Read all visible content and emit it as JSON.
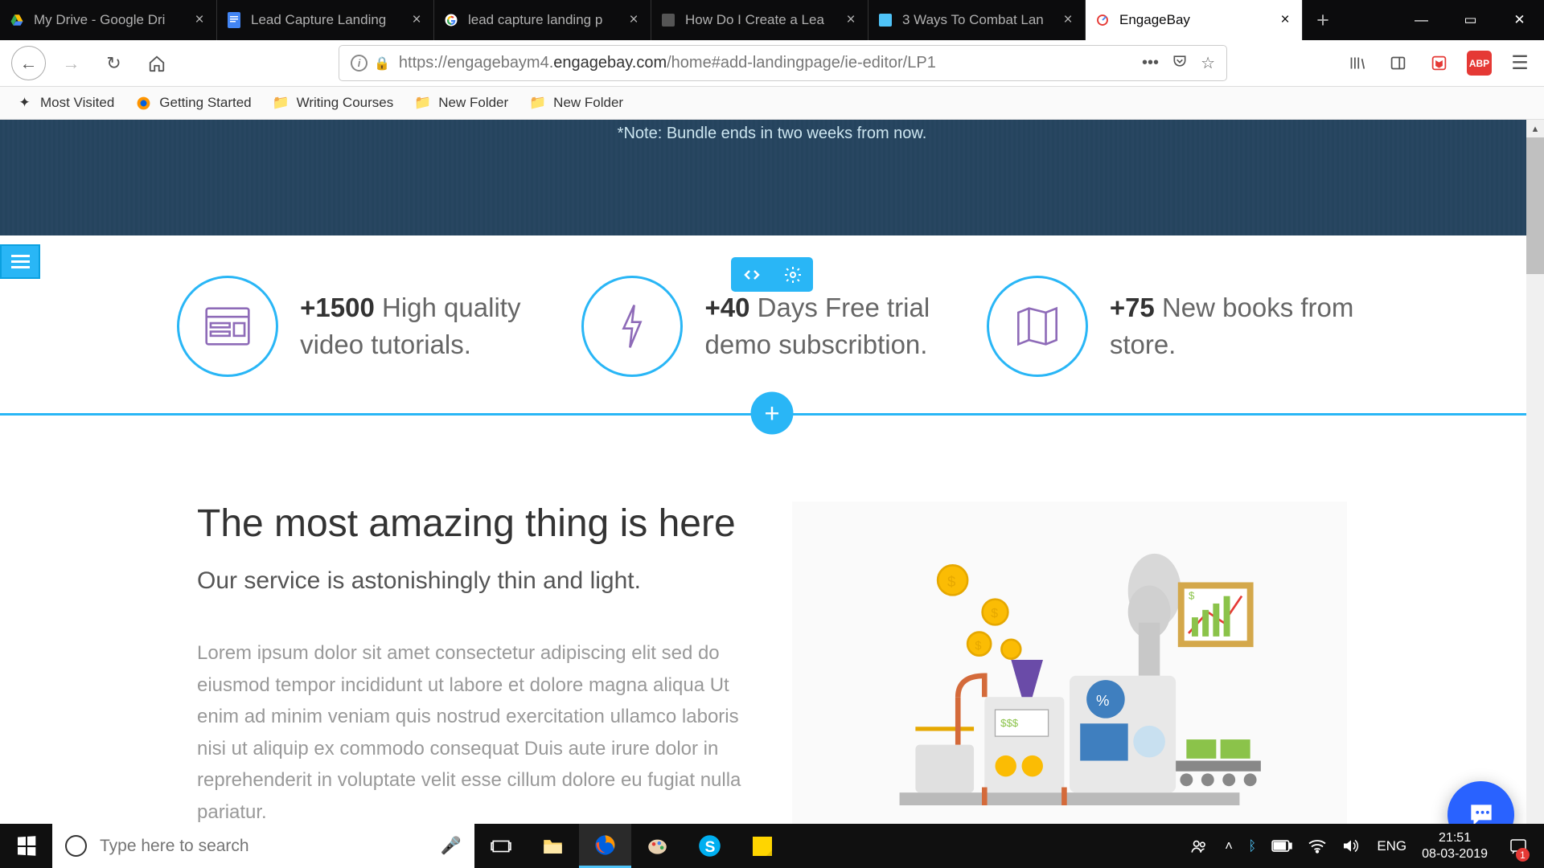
{
  "tabs": [
    {
      "title": "My Drive - Google Dri",
      "icon": "gdrive"
    },
    {
      "title": "Lead Capture Landing",
      "icon": "gdocs"
    },
    {
      "title": "lead capture landing p",
      "icon": "google"
    },
    {
      "title": "How Do I Create a Lea",
      "icon": "generic"
    },
    {
      "title": "3 Ways To Combat Lan",
      "icon": "hub"
    },
    {
      "title": "EngageBay",
      "icon": "engagebay",
      "active": true
    }
  ],
  "url": {
    "prefix": "https://engagebaym4.",
    "domain": "engagebay.com",
    "suffix": "/home#add-landingpage/ie-editor/LP1"
  },
  "bookmarks": [
    {
      "label": "Most Visited",
      "icon": "star"
    },
    {
      "label": "Getting Started",
      "icon": "firefox"
    },
    {
      "label": "Writing Courses",
      "icon": "folder"
    },
    {
      "label": "New Folder",
      "icon": "folder"
    },
    {
      "label": "New Folder",
      "icon": "folder"
    }
  ],
  "hero": {
    "note": "*Note: Bundle ends in two weeks from now."
  },
  "features": [
    {
      "stat": "+1500",
      "text": " High quality video tutorials."
    },
    {
      "stat": "+40",
      "text": " Days Free trial demo subscribtion."
    },
    {
      "stat": "+75",
      "text": " New books from store."
    }
  ],
  "content": {
    "title": "The most amazing thing is here",
    "subtitle": "Our service is astonishingly thin and light.",
    "body": "Lorem ipsum dolor sit amet consectetur adipiscing elit sed do eiusmod tempor incididunt ut labore et dolore magna aliqua Ut enim ad minim veniam quis nostrud exercitation ullamco laboris nisi ut aliquip ex commodo consequat Duis aute irure dolor in reprehenderit in voluptate velit esse cillum dolore eu fugiat nulla pariatur."
  },
  "search": {
    "placeholder": "Type here to search"
  },
  "tray": {
    "lang": "ENG",
    "time": "21:51",
    "date": "08-03-2019",
    "notif_count": "1"
  }
}
